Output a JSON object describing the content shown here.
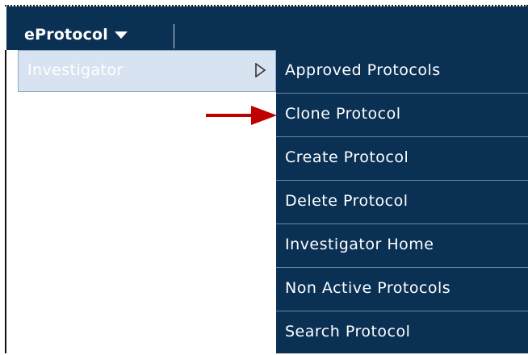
{
  "navbar": {
    "menu_label": "eProtocol",
    "menu_icon": "chevron-down-icon"
  },
  "investigator": {
    "label": "Investigator",
    "submenu_icon": "submenu-arrow-icon"
  },
  "submenu": {
    "items": [
      {
        "label": "Approved Protocols"
      },
      {
        "label": "Clone Protocol"
      },
      {
        "label": "Create Protocol"
      },
      {
        "label": "Delete Protocol"
      },
      {
        "label": "Investigator Home"
      },
      {
        "label": "Non Active Protocols"
      },
      {
        "label": "Search Protocol"
      }
    ]
  },
  "annotation": {
    "pointer_icon": "red-arrow-icon",
    "pointer_color": "#c00000"
  },
  "colors": {
    "menu_background": "#0a3054",
    "highlight_background": "#d7e3f0",
    "text": "#ffffff"
  }
}
